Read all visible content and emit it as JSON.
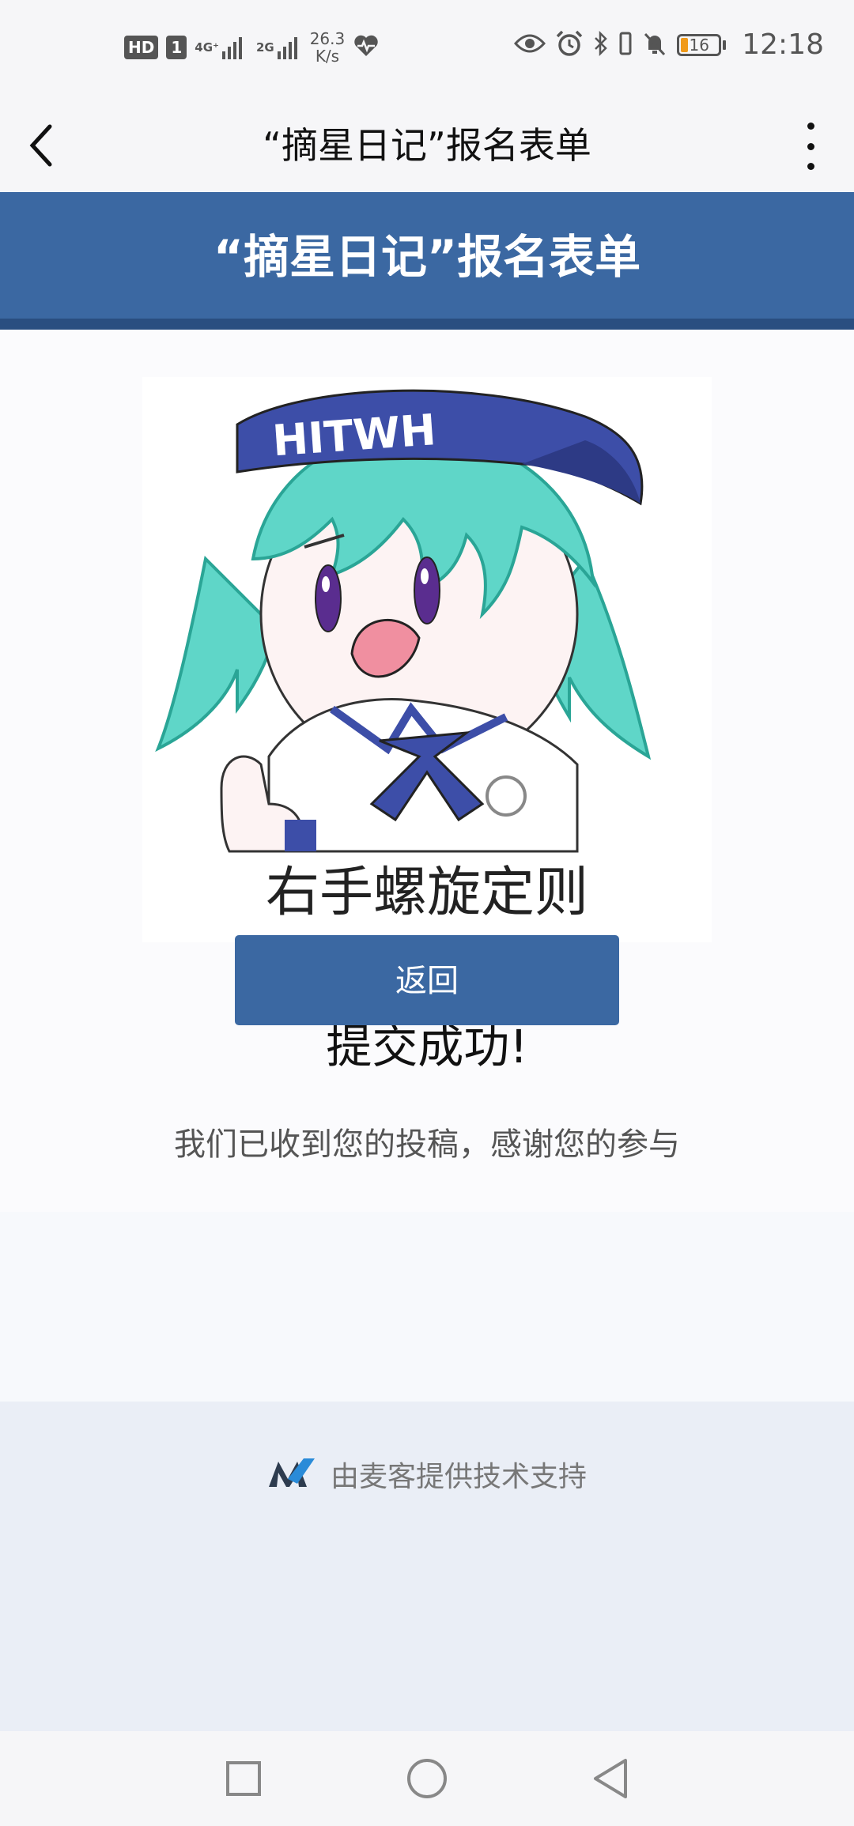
{
  "status_bar": {
    "hd_label": "HD",
    "sim_number": "1",
    "network_1": "4G⁺",
    "network_2": "2G",
    "speed_value": "26.3",
    "speed_unit": "K/s",
    "battery_level": "16",
    "time": "12:18",
    "battery_color": "#f09a1a"
  },
  "nav": {
    "title": "“摘星日记”报名表单",
    "back_icon": "chevron-left-icon",
    "more_icon": "more-vertical-icon"
  },
  "form": {
    "header_title": "“摘星日记”报名表单",
    "accent_color": "#3b68a2"
  },
  "illustration": {
    "cap_text": "HITWH",
    "caption": "右手螺旋定则"
  },
  "result": {
    "title": "提交成功!",
    "message": "我们已收到您的投稿，感谢您的参与",
    "return_label": "返回"
  },
  "footer": {
    "text": "由麦客提供技术支持",
    "logo_icon": "maike-logo-icon"
  },
  "system_nav": {
    "recents_icon": "square-icon",
    "home_icon": "circle-icon",
    "back_icon": "triangle-back-icon"
  }
}
